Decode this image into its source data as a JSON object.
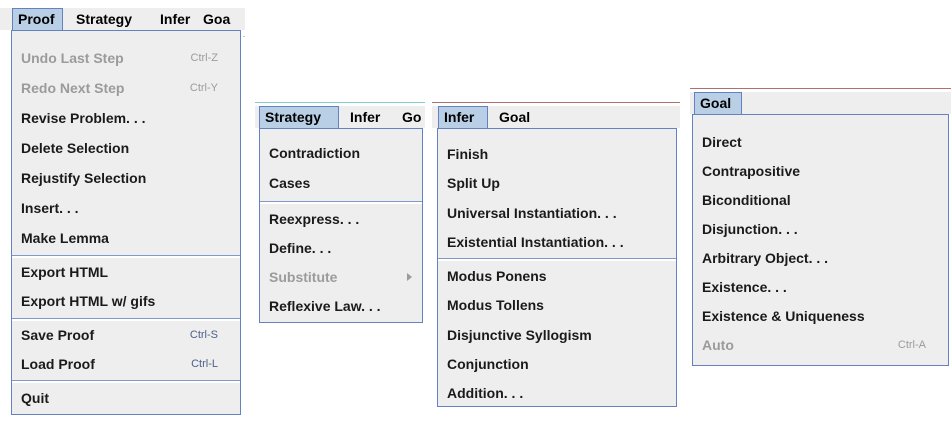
{
  "proof_panel": {
    "menubar": [
      "Proof",
      "Strategy",
      "Infer",
      "Goa"
    ],
    "items": [
      {
        "label": "Undo Last Step",
        "accel": "Ctrl-Z",
        "enabled": false
      },
      {
        "label": "Redo Next Step",
        "accel": "Ctrl-Y",
        "enabled": false
      },
      {
        "label": "Revise Problem. . .",
        "accel": "",
        "enabled": true
      },
      {
        "label": "Delete Selection",
        "accel": "",
        "enabled": true
      },
      {
        "label": "Rejustify Selection",
        "accel": "",
        "enabled": true
      },
      {
        "label": "Insert. . .",
        "accel": "",
        "enabled": true
      },
      {
        "label": "Make Lemma",
        "accel": "",
        "enabled": true
      },
      {
        "label": "Export HTML",
        "accel": "",
        "enabled": true
      },
      {
        "label": "Export HTML w/ gifs",
        "accel": "",
        "enabled": true
      },
      {
        "label": "Save Proof",
        "accel": "Ctrl-S",
        "enabled": true
      },
      {
        "label": "Load Proof",
        "accel": "Ctrl-L",
        "enabled": true
      },
      {
        "label": "Quit",
        "accel": "",
        "enabled": true
      }
    ]
  },
  "strategy_panel": {
    "menubar": [
      "Strategy",
      "Infer",
      "Go"
    ],
    "items": [
      {
        "label": "Contradiction",
        "enabled": true
      },
      {
        "label": "Cases",
        "enabled": true
      },
      {
        "label": "Reexpress. . .",
        "enabled": true
      },
      {
        "label": "Define. . .",
        "enabled": true
      },
      {
        "label": "Substitute",
        "enabled": false,
        "submenu": true
      },
      {
        "label": "Reflexive Law. . .",
        "enabled": true
      }
    ]
  },
  "infer_panel": {
    "menubar": [
      "Infer",
      "Goal"
    ],
    "items": [
      {
        "label": "Finish",
        "enabled": true
      },
      {
        "label": "Split Up",
        "enabled": true
      },
      {
        "label": "Universal Instantiation. . .",
        "enabled": true
      },
      {
        "label": "Existential Instantiation. . .",
        "enabled": true
      },
      {
        "label": "Modus Ponens",
        "enabled": true
      },
      {
        "label": "Modus Tollens",
        "enabled": true
      },
      {
        "label": "Disjunctive Syllogism",
        "enabled": true
      },
      {
        "label": "Conjunction",
        "enabled": true
      },
      {
        "label": "Addition. . .",
        "enabled": true
      }
    ]
  },
  "goal_panel": {
    "menubar": [
      "Goal"
    ],
    "items": [
      {
        "label": "Direct",
        "accel": "",
        "enabled": true
      },
      {
        "label": "Contrapositive",
        "accel": "",
        "enabled": true
      },
      {
        "label": "Biconditional",
        "accel": "",
        "enabled": true
      },
      {
        "label": "Disjunction. . .",
        "accel": "",
        "enabled": true
      },
      {
        "label": "Arbitrary Object. . .",
        "accel": "",
        "enabled": true
      },
      {
        "label": "Existence. . .",
        "accel": "",
        "enabled": true
      },
      {
        "label": "Existence & Uniqueness",
        "accel": "",
        "enabled": true
      },
      {
        "label": "Auto",
        "accel": "Ctrl-A",
        "enabled": false
      }
    ]
  },
  "colors": {
    "menu_bg": "#eeeeee",
    "highlight": "#b8cfe5",
    "border": "#6382bf",
    "disabled_text": "#9b9b9b"
  }
}
